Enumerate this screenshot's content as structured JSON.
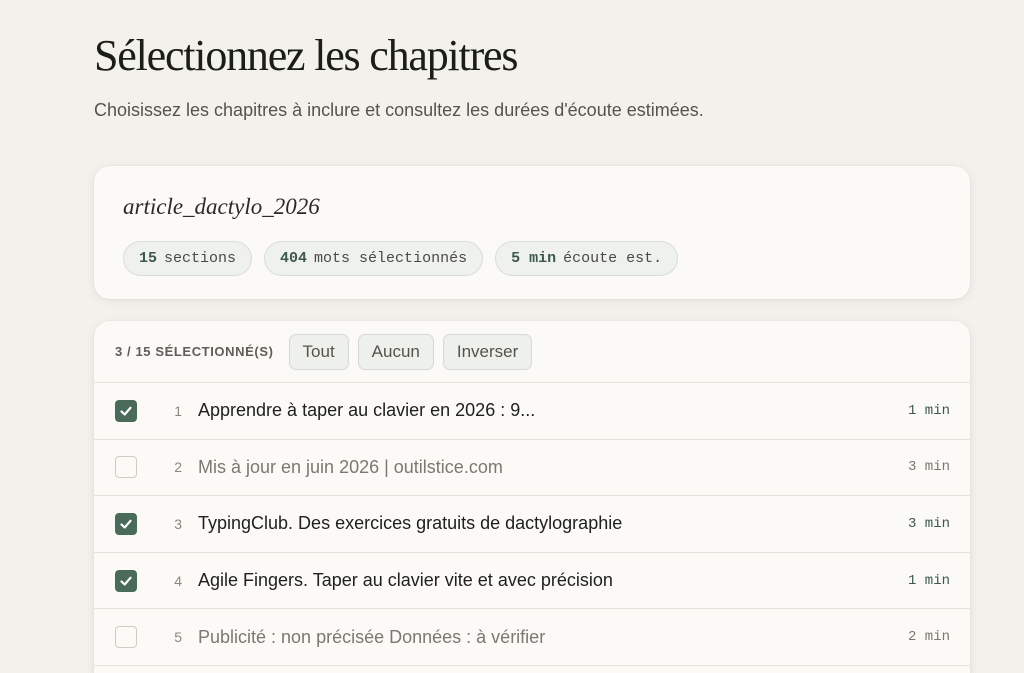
{
  "header": {
    "title": "Sélectionnez les chapitres",
    "subtitle": "Choisissez les chapitres à inclure et consultez les durées d'écoute estimées."
  },
  "summary": {
    "file_name": "article_dactylo_2026",
    "stats": [
      {
        "value": "15",
        "label": "sections"
      },
      {
        "value": "404",
        "label": "mots sélectionnés"
      },
      {
        "value": "5 min",
        "label": "écoute est."
      }
    ]
  },
  "toolbar": {
    "count_label": "3 / 15 SÉLECTIONNÉ(S)",
    "all_label": "Tout",
    "none_label": "Aucun",
    "invert_label": "Inverser"
  },
  "chapters": [
    {
      "index": "1",
      "title": "Apprendre à taper au clavier en 2026 : 9...",
      "duration": "1 min",
      "checked": true
    },
    {
      "index": "2",
      "title": "Mis à jour en juin 2026 | outilstice.com",
      "duration": "3 min",
      "checked": false
    },
    {
      "index": "3",
      "title": "TypingClub. Des exercices gratuits de dactylographie",
      "duration": "3 min",
      "checked": true
    },
    {
      "index": "4",
      "title": "Agile Fingers. Taper au clavier vite et avec précision",
      "duration": "1 min",
      "checked": true
    },
    {
      "index": "5",
      "title": "Publicité : non précisée Données : à vérifier",
      "duration": "2 min",
      "checked": false
    }
  ],
  "colors": {
    "accent": "#4a6a5a",
    "background": "#f3f1ec",
    "card": "#fbfaf7"
  }
}
